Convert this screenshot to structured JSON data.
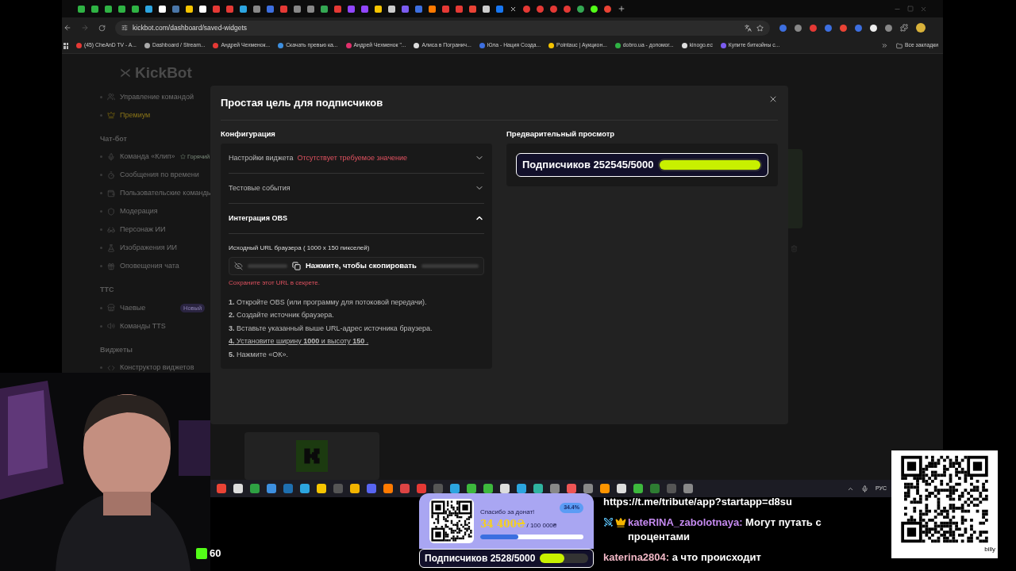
{
  "browser": {
    "url": "kickbot.com/dashboard/saved-widgets",
    "bookmarks": [
      "(45) CheAnD TV - A...",
      "Dashboard / Stream...",
      "Андрей Чехменок...",
      "Скачать превью ка...",
      "Андрей Чехменок \"...",
      "Алиса в Погранич...",
      "Юла - Нация Созда...",
      "Pointauc | Аукцион...",
      "dobro.ua - допомог...",
      "kinogo.ec",
      "Купите биткойны с..."
    ],
    "all_bookmarks": "Все закладки"
  },
  "sidebar": {
    "logo": "KickBot",
    "items": [
      {
        "kind": "item",
        "label": "Управление командой"
      },
      {
        "kind": "premium",
        "label": "Премиум"
      },
      {
        "kind": "section",
        "label": "Чат-бот"
      },
      {
        "kind": "item",
        "label": "Команда «Клип»",
        "badge": {
          "kind": "hot",
          "text": "Горячий"
        }
      },
      {
        "kind": "item",
        "label": "Сообщения по времени"
      },
      {
        "kind": "item",
        "label": "Пользовательские команды"
      },
      {
        "kind": "item",
        "label": "Модерация"
      },
      {
        "kind": "item",
        "label": "Персонаж ИИ"
      },
      {
        "kind": "item",
        "label": "Изображения ИИ"
      },
      {
        "kind": "item",
        "label": "Оповещения чата"
      },
      {
        "kind": "section",
        "label": "TTC"
      },
      {
        "kind": "item",
        "label": "Чаевые",
        "badge": {
          "kind": "new",
          "text": "Новый"
        }
      },
      {
        "kind": "item",
        "label": "Команды TTS"
      },
      {
        "kind": "section",
        "label": "Виджеты"
      },
      {
        "kind": "item",
        "label": "Конструктор виджетов"
      }
    ]
  },
  "modal": {
    "title": "Простая цель для подписчиков",
    "config_heading": "Конфигурация",
    "preview_heading": "Предварительный просмотр",
    "sections": [
      {
        "title": "Настройки виджета",
        "warning": "Отсутствует требуемое значение",
        "expanded": false
      },
      {
        "title": "Тестовые события",
        "expanded": false
      },
      {
        "title": "Интеграция OBS",
        "expanded": true
      }
    ],
    "obs": {
      "url_label": "Исходный URL браузера ( 1000 x 150 пикселей)",
      "copy_hint": "Нажмите, чтобы скопировать",
      "secret_note": "Сохраните этот URL в секрете.",
      "steps": [
        {
          "text": "**1.** Откройте OBS (или программу для потоковой передачи).",
          "underlined": false
        },
        {
          "text": "**2.** Создайте источник браузера.",
          "underlined": false
        },
        {
          "text": "**3.** Вставьте указанный выше URL-адрес источника браузера.",
          "underlined": false
        },
        {
          "text": "**4.** Установите ширину **1000** и высоту **150** .",
          "underlined": true
        },
        {
          "text": "**5.** Нажмите «ОК».",
          "underlined": false
        }
      ]
    },
    "preview": {
      "label": "Подписчиков 252545/5000",
      "level": 1
    }
  },
  "taskbar": {
    "language": "РУС"
  },
  "donation": {
    "thanks": "Спасибо за донат!",
    "raised": "34 400₴",
    "goal": "/ 100 000₴",
    "percent": "34.4%",
    "level": 0.37
  },
  "sub_goal": {
    "label": "Подписчиков 2528/5000",
    "level": 0.5
  },
  "chat": [
    {
      "kind": "link",
      "text": "https://t.me/tribute/app?startapp=d8su"
    },
    {
      "kind": "message",
      "user": "kateRINA_zabolotnaya:",
      "color": "#c58af0",
      "badges": true,
      "text": "Могут путать с процентами"
    },
    {
      "kind": "message",
      "user": "katerina2804:",
      "color": "#f2b8c6",
      "badges": false,
      "text": "а что происходит"
    }
  ],
  "qr": {
    "caption": "billy"
  },
  "viewers": {
    "count": "60"
  }
}
